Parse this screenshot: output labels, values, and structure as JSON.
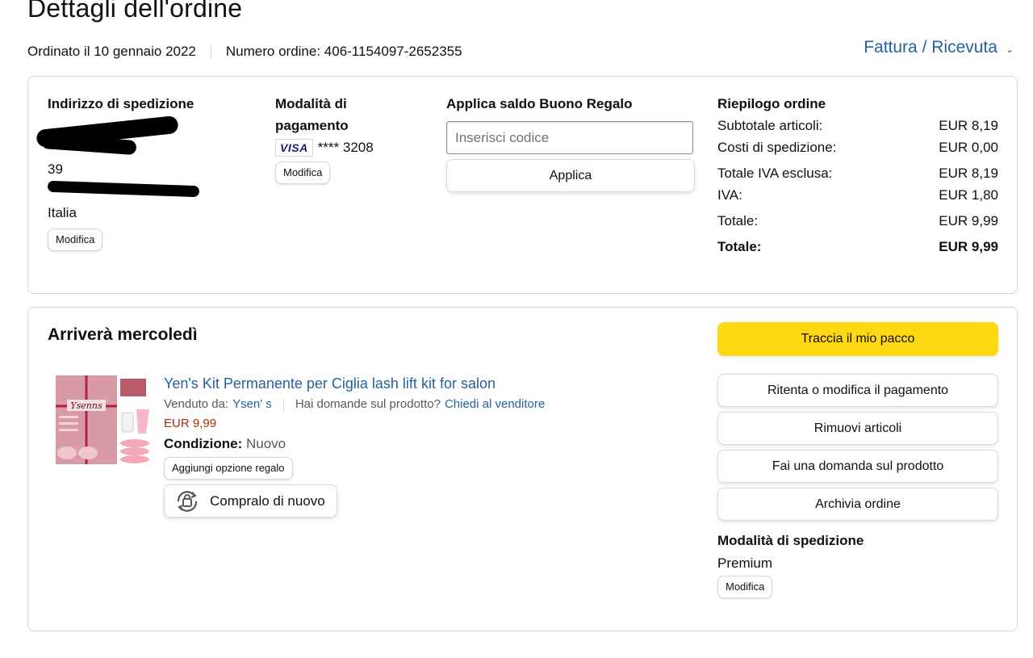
{
  "page": {
    "title": "Dettagli dell'ordine",
    "ordered_on": "Ordinato il 10 gennaio 2022",
    "order_number": "Numero ordine: 406-1154097-2652355",
    "invoice_link": "Fattura / Ricevuta"
  },
  "address": {
    "heading": "Indirizzo di spedizione",
    "line_3": "39",
    "country": "Italia",
    "edit_label": "Modifica"
  },
  "payment": {
    "heading_1": "Modalità di",
    "heading_2": "pagamento",
    "card_brand": "VISA",
    "card_number": "**** 3208",
    "edit_label": "Modifica"
  },
  "gift": {
    "heading": "Applica saldo Buono Regalo",
    "placeholder": "Inserisci codice",
    "apply_label": "Applica"
  },
  "summary": {
    "heading": "Riepilogo ordine",
    "rows": [
      {
        "label": "Subtotale articoli:",
        "value": "EUR 8,19"
      },
      {
        "label": "Costi di spedizione:",
        "value": "EUR 0,00"
      },
      {
        "label": "Totale IVA esclusa:",
        "value": "EUR 8,19"
      },
      {
        "label": "IVA:",
        "value": "EUR 1,80"
      },
      {
        "label": "Totale:",
        "value": "EUR 9,99"
      }
    ],
    "grand_total_label": "Totale:",
    "grand_total_value": "EUR 9,99"
  },
  "shipment": {
    "heading": "Arriverà mercoledì",
    "product": {
      "title": "Yen's Kit Permanente per Ciglia lash lift kit for salon",
      "sold_by_label": "Venduto da:",
      "seller": "Ysen' s",
      "question_label": "Hai domande sul prodotto?",
      "contact_seller": "Chiedi al venditore",
      "price": "EUR 9,99",
      "condition_label": "Condizione:",
      "condition_value": "Nuovo",
      "gift_option": "Aggiungi opzione regalo",
      "buy_again": "Compralo di nuovo",
      "image_brand": "Ysenns"
    },
    "actions": {
      "track": "Traccia il mio pacco",
      "retry_payment": "Ritenta o modifica il pagamento",
      "remove_items": "Rimuovi articoli",
      "ask_question": "Fai una domanda sul prodotto",
      "archive": "Archivia ordine"
    },
    "shipping_method": {
      "heading": "Modalità di spedizione",
      "value": "Premium",
      "edit_label": "Modifica"
    }
  },
  "colors": {
    "link": "#2162a1",
    "price": "#b12704",
    "track_button": "#ffd814",
    "border": "#d5d9d9"
  }
}
